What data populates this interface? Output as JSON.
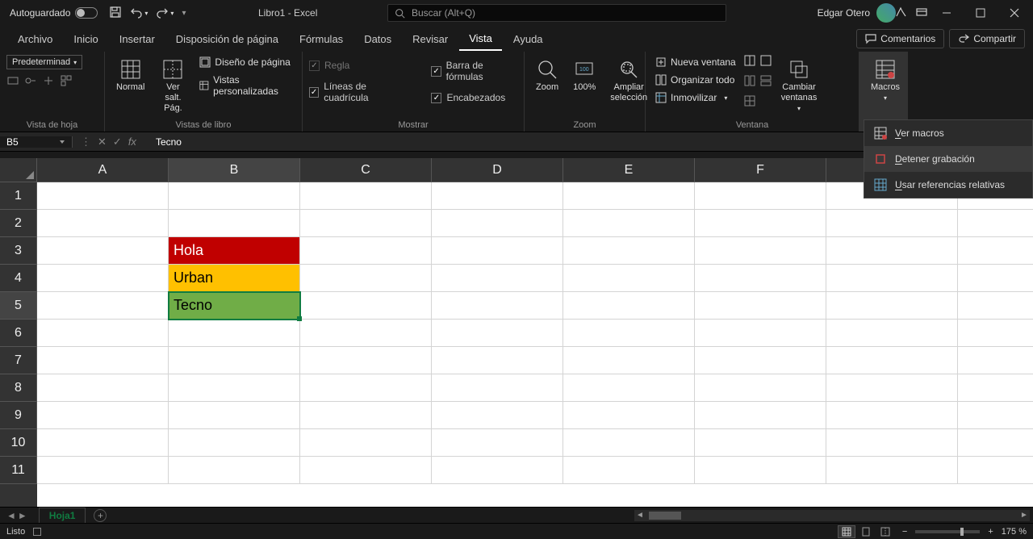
{
  "titlebar": {
    "autosave": "Autoguardado",
    "doc_title": "Libro1  -  Excel",
    "search_placeholder": "Buscar (Alt+Q)",
    "user": "Edgar Otero"
  },
  "menu": {
    "archivo": "Archivo",
    "inicio": "Inicio",
    "insertar": "Insertar",
    "disposicion": "Disposición de página",
    "formulas": "Fórmulas",
    "datos": "Datos",
    "revisar": "Revisar",
    "vista": "Vista",
    "ayuda": "Ayuda",
    "comentarios": "Comentarios",
    "compartir": "Compartir"
  },
  "ribbon": {
    "vista_hoja": {
      "label": "Vista de hoja",
      "predeterminado": "Predeterminad"
    },
    "vistas_libro": {
      "label": "Vistas de libro",
      "normal": "Normal",
      "salto": "Ver salt.\nPág.",
      "diseno": "Diseño de página",
      "personalizadas": "Vistas personalizadas"
    },
    "mostrar": {
      "label": "Mostrar",
      "regla": "Regla",
      "barra": "Barra de fórmulas",
      "cuadricula": "Líneas de cuadrícula",
      "encabezados": "Encabezados"
    },
    "zoom": {
      "label": "Zoom",
      "zoom": "Zoom",
      "cien": "100%",
      "ampliar": "Ampliar\nselección"
    },
    "ventana": {
      "label": "Ventana",
      "nueva": "Nueva ventana",
      "organizar": "Organizar todo",
      "inmovilizar": "Inmovilizar",
      "cambiar": "Cambiar\nventanas"
    },
    "macros": {
      "label": "Macros"
    }
  },
  "macros_menu": {
    "ver": "Ver macros",
    "detener": "Detener grabación",
    "referencias": "Usar referencias relativas"
  },
  "formulabar": {
    "name": "B5",
    "value": "Tecno"
  },
  "columns": [
    "A",
    "B",
    "C",
    "D",
    "E",
    "F"
  ],
  "rows": [
    "1",
    "2",
    "3",
    "4",
    "5",
    "6",
    "7",
    "8",
    "9",
    "10",
    "11"
  ],
  "cells": {
    "B3": {
      "text": "Hola",
      "bg": "#C00000",
      "fg": "#ffffff"
    },
    "B4": {
      "text": "Urban",
      "bg": "#FFC000",
      "fg": "#000000"
    },
    "B5": {
      "text": "Tecno",
      "bg": "#70AD47",
      "fg": "#000000"
    }
  },
  "selected_cell": "B5",
  "sheets": {
    "hoja1": "Hoja1"
  },
  "status": {
    "listo": "Listo",
    "zoom": "175 %"
  }
}
